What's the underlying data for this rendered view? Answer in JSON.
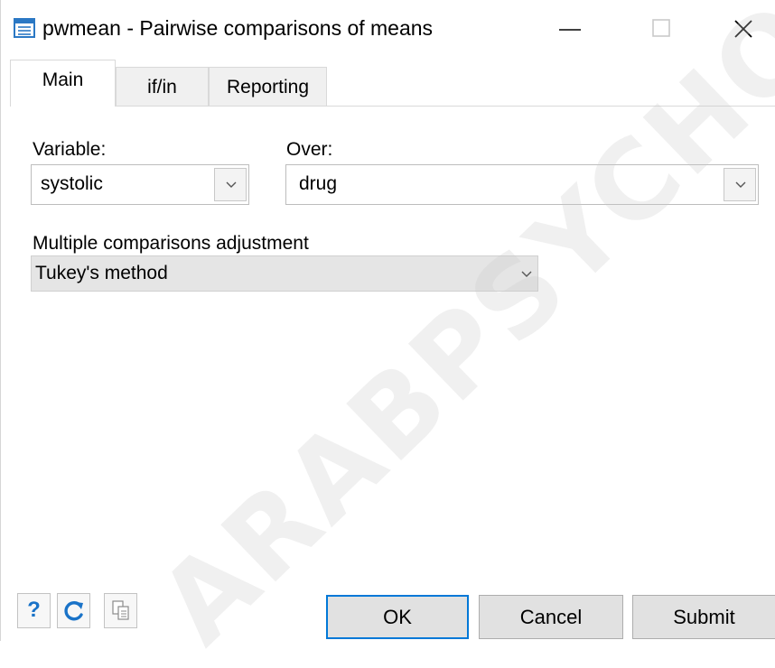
{
  "window": {
    "title": "pwmean - Pairwise comparisons of means",
    "min_glyph": "—",
    "close_glyph": "✕"
  },
  "tabs": [
    {
      "label": "Main",
      "active": true
    },
    {
      "label": "if/in",
      "active": false
    },
    {
      "label": "Reporting",
      "active": false
    }
  ],
  "main": {
    "variable": {
      "label": "Variable:",
      "value": "systolic"
    },
    "over": {
      "label": "Over:",
      "value": "drug"
    },
    "adjustment": {
      "label": "Multiple comparisons adjustment",
      "value": "Tukey's method"
    }
  },
  "footer": {
    "help_glyph": "?",
    "ok_label": "OK",
    "cancel_label": "Cancel",
    "submit_label": "Submit"
  },
  "watermark": "ARABPSYCHOL",
  "colors": {
    "accent": "#0078d7",
    "help_blue": "#1a73c8"
  }
}
